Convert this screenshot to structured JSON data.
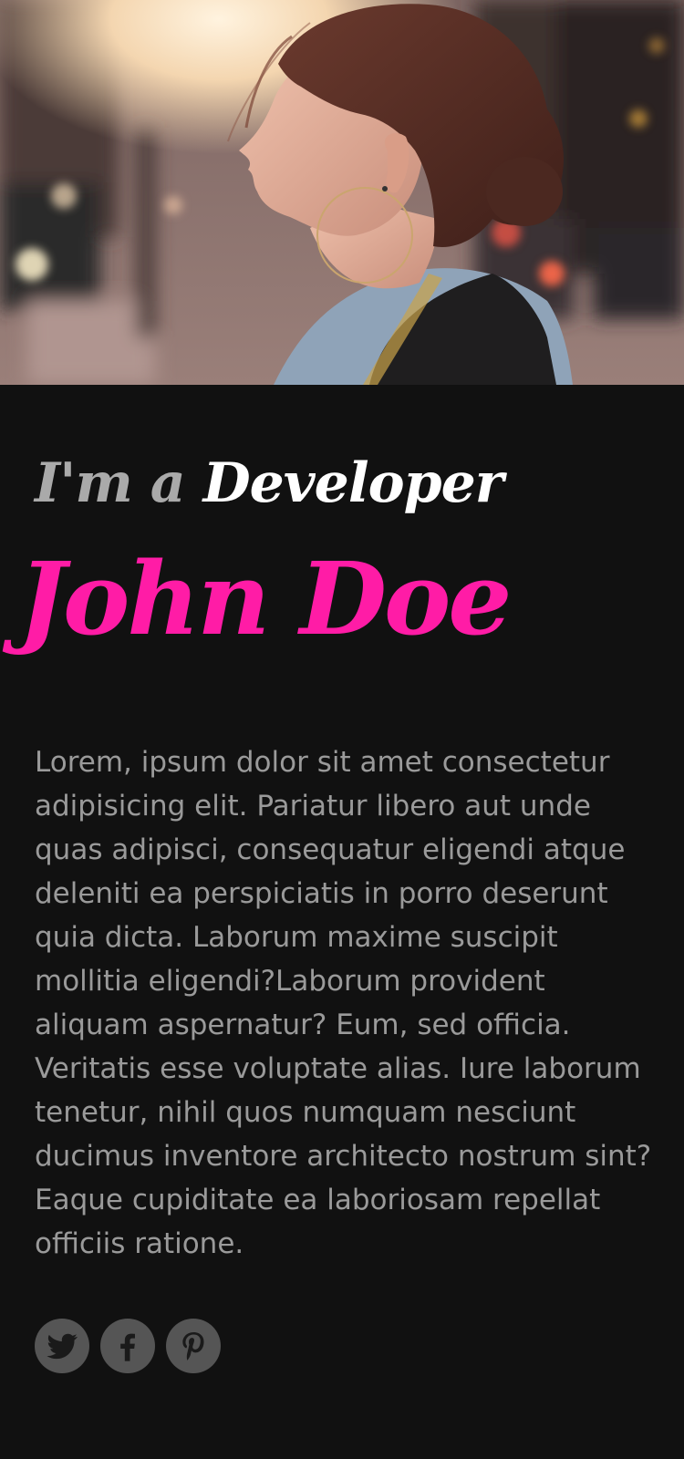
{
  "hero": {
    "image_alt": "hero-photo"
  },
  "tagline": {
    "prefix": "I'm a",
    "role": "Developer"
  },
  "name": "John Doe",
  "bio": "Lorem, ipsum dolor sit amet consectetur adipisicing elit. Pariatur libero aut unde quas adipisci, consequatur eligendi atque deleniti ea perspiciatis in porro deserunt quia dicta. Laborum maxime suscipit mollitia eligendi?Laborum provident aliquam aspernatur? Eum, sed officia. Veritatis esse voluptate alias. Iure laborum tenetur, nihil quos numquam nesciunt ducimus inventore architecto nostrum sint? Eaque cupiditate ea laboriosam repellat officiis ratione.",
  "social": {
    "icons": [
      "twitter-icon",
      "facebook-icon",
      "pinterest-icon"
    ]
  },
  "colors": {
    "background": "#111111",
    "accent": "#ff1ca6",
    "tagline_prefix": "#aaaaaa",
    "tagline_role": "#ffffff",
    "body_text": "#9a9a9a",
    "icon_bg": "#555555"
  }
}
